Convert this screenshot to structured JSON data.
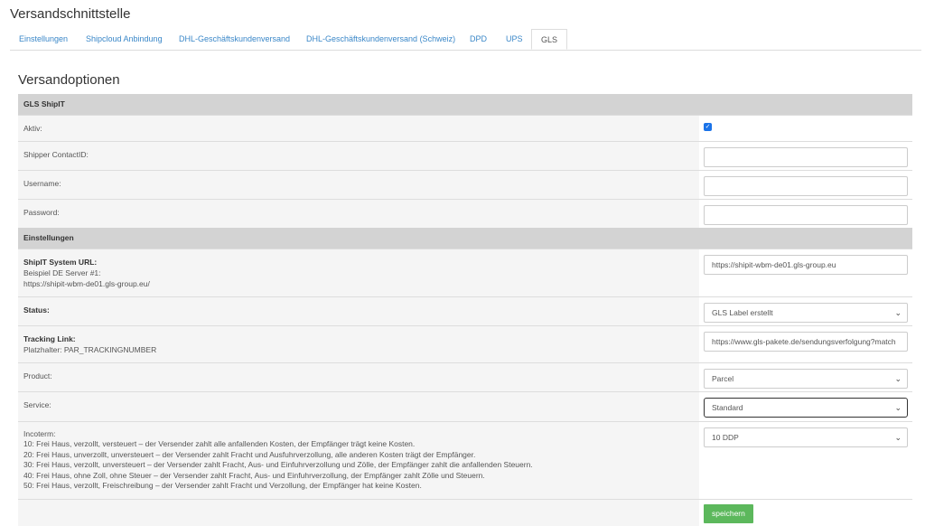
{
  "page": {
    "title": "Versandschnittstelle"
  },
  "tabs": [
    {
      "label": "Einstellungen"
    },
    {
      "label": "Shipcloud Anbindung"
    },
    {
      "label": "DHL-Geschäftskundenversand"
    },
    {
      "label": "DHL-Geschäftskundenversand (Schweiz)"
    },
    {
      "label": "DPD"
    },
    {
      "label": "UPS"
    },
    {
      "label": "GLS"
    }
  ],
  "section": {
    "title": "Versandoptionen"
  },
  "gls": {
    "header": "GLS ShipIT",
    "aktiv_label": "Aktiv:",
    "aktiv_checked": true,
    "contact_label": "Shipper ContactID:",
    "contact_value": "",
    "username_label": "Username:",
    "username_value": "",
    "password_label": "Password:",
    "password_value": ""
  },
  "settings": {
    "header": "Einstellungen",
    "url_label": "ShipIT System URL:",
    "url_hint1": "Beispiel DE Server #1:",
    "url_hint2": "https://shipit-wbm-de01.gls-group.eu/",
    "url_value": "https://shipit-wbm-de01.gls-group.eu",
    "status_label": "Status:",
    "status_value": "GLS Label erstellt",
    "tracking_label": "Tracking Link:",
    "tracking_hint": "Platzhalter: PAR_TRACKINGNUMBER",
    "tracking_value": "https://www.gls-pakete.de/sendungsverfolgung?match",
    "product_label": "Product:",
    "product_value": "Parcel",
    "service_label": "Service:",
    "service_value": "Standard",
    "incoterm_label": "Incoterm:",
    "incoterm_lines": [
      "10: Frei Haus, verzollt, versteuert – der Versender zahlt alle anfallenden Kosten, der Empfänger trägt keine Kosten.",
      "20: Frei Haus, unverzollt, unversteuert – der Versender zahlt Fracht und Ausfuhrverzollung, alle anderen Kosten trägt der Empfänger.",
      "30: Frei Haus, verzollt, unversteuert – der Versender zahlt Fracht, Aus- und Einfuhrverzollung und Zölle, der Empfänger zahlt die anfallenden Steuern.",
      "40: Frei Haus, ohne Zoll, ohne Steuer – der Versender zahlt Fracht, Aus- und Einfuhrverzollung, der Empfänger zahlt Zölle und Steuern.",
      "50: Frei Haus, verzollt, Freischreibung – der Versender zahlt Fracht und Verzollung, der Empfänger hat keine Kosten."
    ],
    "incoterm_value": "10 DDP"
  },
  "actions": {
    "save_label": "speichern"
  },
  "colors": {
    "link": "#3a87c8",
    "header_bg": "#d3d3d3",
    "save_bg": "#5cb85c",
    "checkbox": "#1a73e8"
  }
}
